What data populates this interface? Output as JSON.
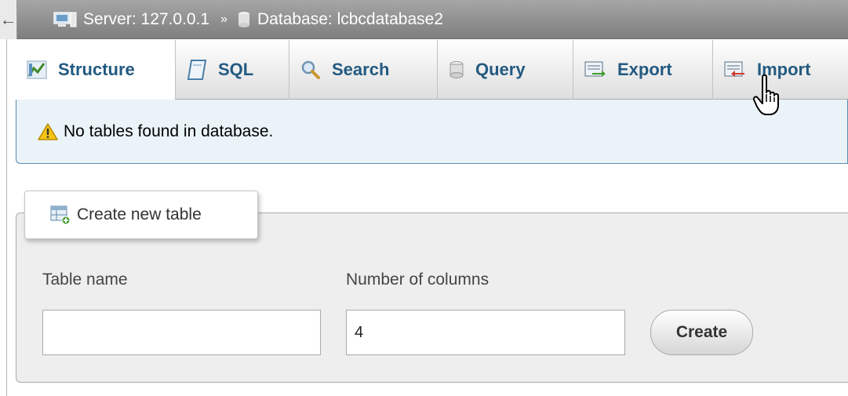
{
  "breadcrumb": {
    "collapse_glyph": "←",
    "server_label": "Server: 127.0.0.1",
    "separator": "»",
    "database_label": "Database: lcbcdatabase2"
  },
  "tabs": [
    {
      "label": "Structure",
      "icon": "structure-icon"
    },
    {
      "label": "SQL",
      "icon": "sql-icon"
    },
    {
      "label": "Search",
      "icon": "search-icon"
    },
    {
      "label": "Query",
      "icon": "query-icon"
    },
    {
      "label": "Export",
      "icon": "export-icon"
    },
    {
      "label": "Import",
      "icon": "import-icon"
    }
  ],
  "notice": {
    "text": "No tables found in database.",
    "icon": "warning-icon"
  },
  "create_table": {
    "legend": "Create new table",
    "table_name_label": "Table name",
    "table_name_value": "",
    "num_columns_label": "Number of columns",
    "num_columns_value": "4",
    "create_label": "Create"
  },
  "colors": {
    "tab_text": "#235a81",
    "notice_bg": "#eaf3f8",
    "notice_border": "#5a8dae"
  }
}
